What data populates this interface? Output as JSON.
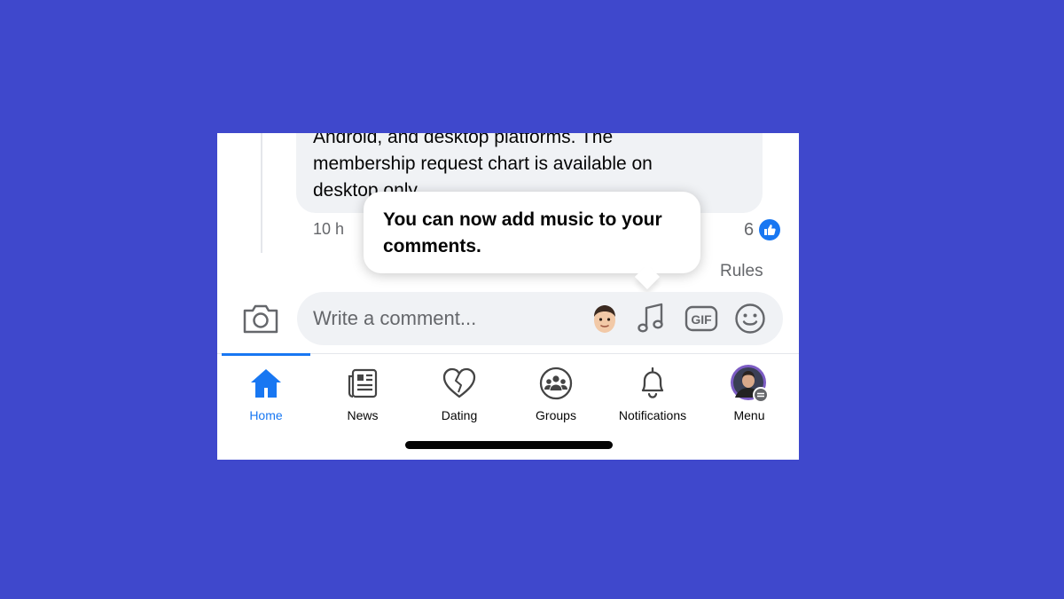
{
  "comment": {
    "lines": [
      "Android, and desktop platforms. The",
      "membership request chart is available on",
      "desktop only."
    ],
    "timestamp": "10 h",
    "like_count": "6"
  },
  "rules_link": "Rules",
  "tooltip": {
    "text": "You can now add music to your comments."
  },
  "composer": {
    "placeholder": "Write a comment...",
    "gif_label": "GIF"
  },
  "nav": {
    "tabs": [
      {
        "label": "Home",
        "icon": "home-icon",
        "active": true
      },
      {
        "label": "News",
        "icon": "news-icon",
        "active": false
      },
      {
        "label": "Dating",
        "icon": "heart-icon",
        "active": false
      },
      {
        "label": "Groups",
        "icon": "groups-icon",
        "active": false
      },
      {
        "label": "Notifications",
        "icon": "bell-icon",
        "active": false
      },
      {
        "label": "Menu",
        "icon": "avatar-icon",
        "active": false
      }
    ]
  },
  "colors": {
    "background": "#3f48cc",
    "accent": "#1877f2",
    "bubble": "#f0f2f5"
  }
}
